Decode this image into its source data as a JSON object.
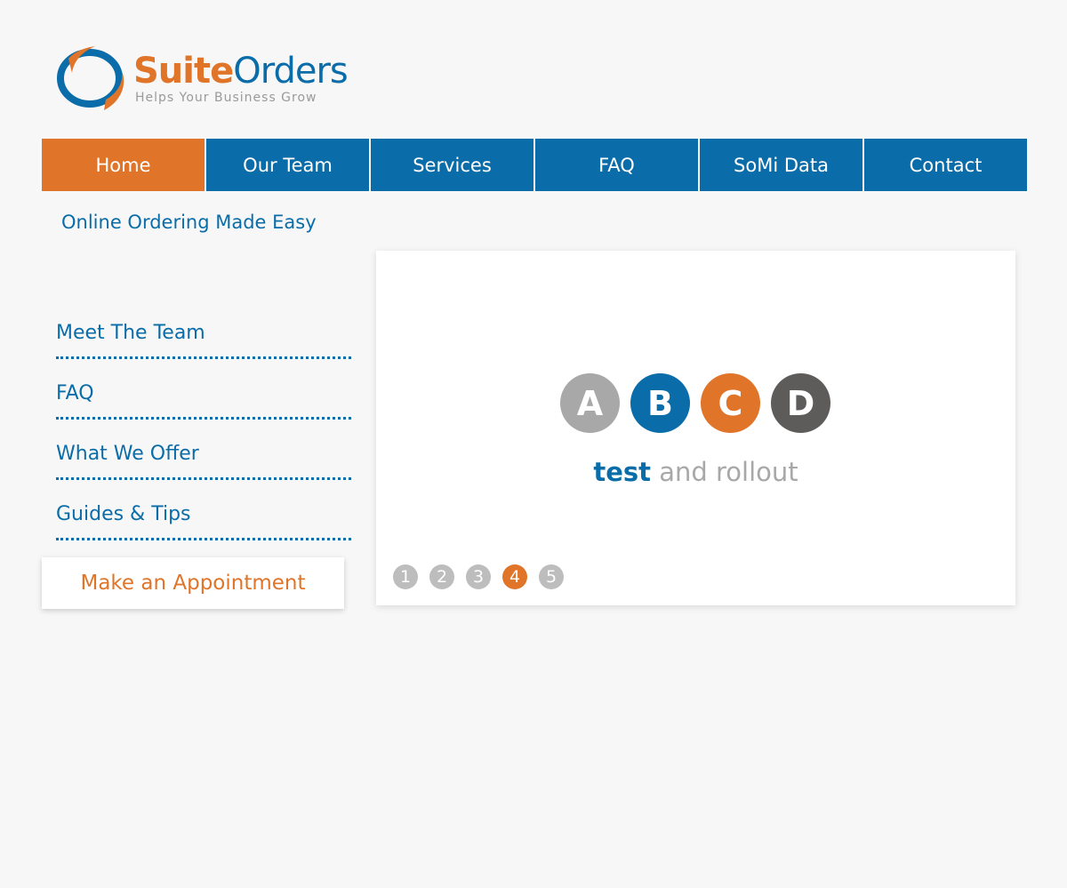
{
  "brand": {
    "name_part1": "Suite",
    "name_part2": "Orders",
    "tagline": "Helps Your Business Grow",
    "colors": {
      "orange": "#e07429",
      "blue": "#0a6ca8"
    }
  },
  "nav": {
    "items": [
      {
        "label": "Home",
        "active": true
      },
      {
        "label": "Our Team",
        "active": false
      },
      {
        "label": "Services",
        "active": false
      },
      {
        "label": "FAQ",
        "active": false
      },
      {
        "label": "SoMi Data",
        "active": false
      },
      {
        "label": "Contact",
        "active": false
      }
    ]
  },
  "sub_tagline": "Online Ordering Made Easy",
  "sidebar": {
    "links": [
      {
        "label": "Meet The Team"
      },
      {
        "label": "FAQ"
      },
      {
        "label": "What We Offer"
      },
      {
        "label": "Guides & Tips"
      }
    ],
    "appointment_label": "Make an Appointment"
  },
  "slider": {
    "letters": [
      {
        "char": "A",
        "color": "#a8a8a8"
      },
      {
        "char": "B",
        "color": "#0a6ca8"
      },
      {
        "char": "C",
        "color": "#e07429"
      },
      {
        "char": "D",
        "color": "#5e5b5b"
      }
    ],
    "caption_emphasis": "test",
    "caption_rest": " and rollout",
    "pages": [
      "1",
      "2",
      "3",
      "4",
      "5"
    ],
    "active_page": "4"
  }
}
